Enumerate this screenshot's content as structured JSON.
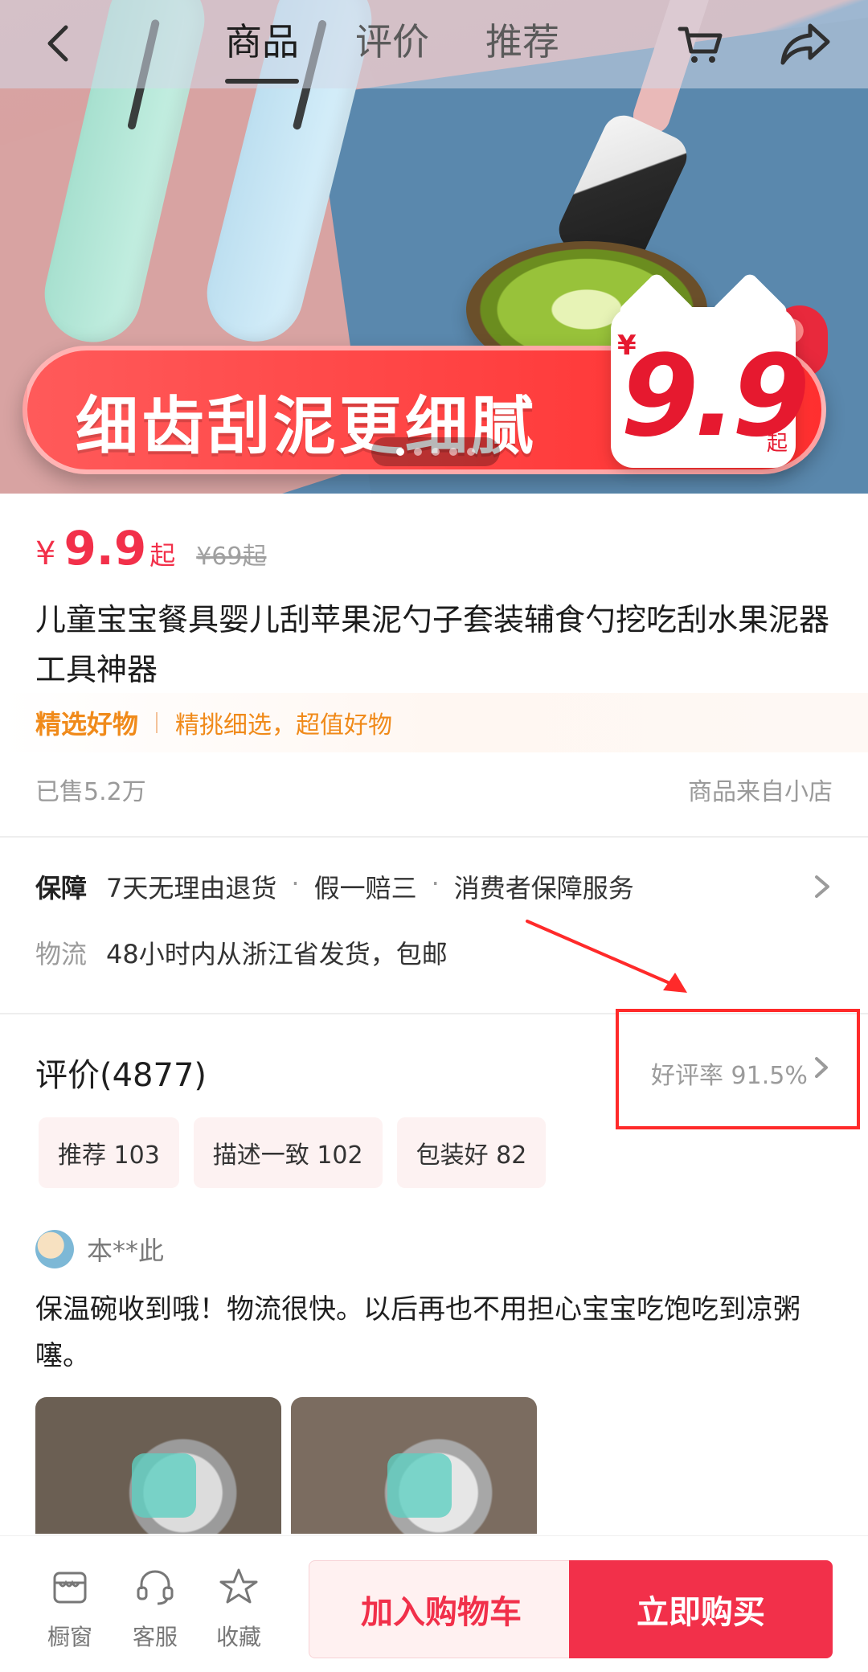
{
  "hero": {
    "banner_text": "细齿刮泥更细腻",
    "promo_yen": "¥",
    "promo_price": "9.9",
    "promo_qi": "起",
    "carousel_dots": 5,
    "carousel_active_index": 0,
    "colors": {
      "banner": "#ff2f2f",
      "price": "#e6192f"
    }
  },
  "top_nav": {
    "tabs": [
      {
        "label": "商品",
        "active": true
      },
      {
        "label": "评价",
        "active": false
      },
      {
        "label": "推荐",
        "active": false
      }
    ],
    "icons": {
      "back": "chevron-left-icon",
      "cart": "cart-icon",
      "share": "share-icon"
    }
  },
  "product": {
    "price_yen": "¥",
    "price": "9.9",
    "price_suffix": "起",
    "original_price": "¥69起",
    "title": "儿童宝宝餐具婴儿刮苹果泥勺子套装辅食勺挖吃刮水果泥器工具神器",
    "promo_title": "精选好物",
    "promo_subtitle": "精挑细选，超值好物",
    "sold": "已售5.2万",
    "source": "商品来自小店",
    "accent": "#f2304a",
    "promo_color": "#f08a1a"
  },
  "service": {
    "guarantee_label": "保障",
    "guarantee_items": [
      "7天无理由退货",
      "假一赔三",
      "消费者保障服务"
    ],
    "bullet": "·",
    "logistics_label": "物流",
    "logistics_text": "48小时内从浙江省发货，包邮"
  },
  "reviews": {
    "title": "评价(4877)",
    "rating_text": "好评率 91.5%",
    "tags": [
      "推荐 103",
      "描述一致 102",
      "包装好 82"
    ],
    "reviewer_name": "本**此",
    "review_text": "保温碗收到哦！物流很快。以后再也不用担心宝宝吃饱吃到凉粥噻。",
    "annotation_color": "#ff2a2a"
  },
  "bottom_bar": {
    "icons": [
      {
        "label": "橱窗",
        "icon": "storefront-icon"
      },
      {
        "label": "客服",
        "icon": "headset-icon"
      },
      {
        "label": "收藏",
        "icon": "star-icon"
      }
    ],
    "add_to_cart": "加入购物车",
    "buy_now": "立即购买"
  }
}
